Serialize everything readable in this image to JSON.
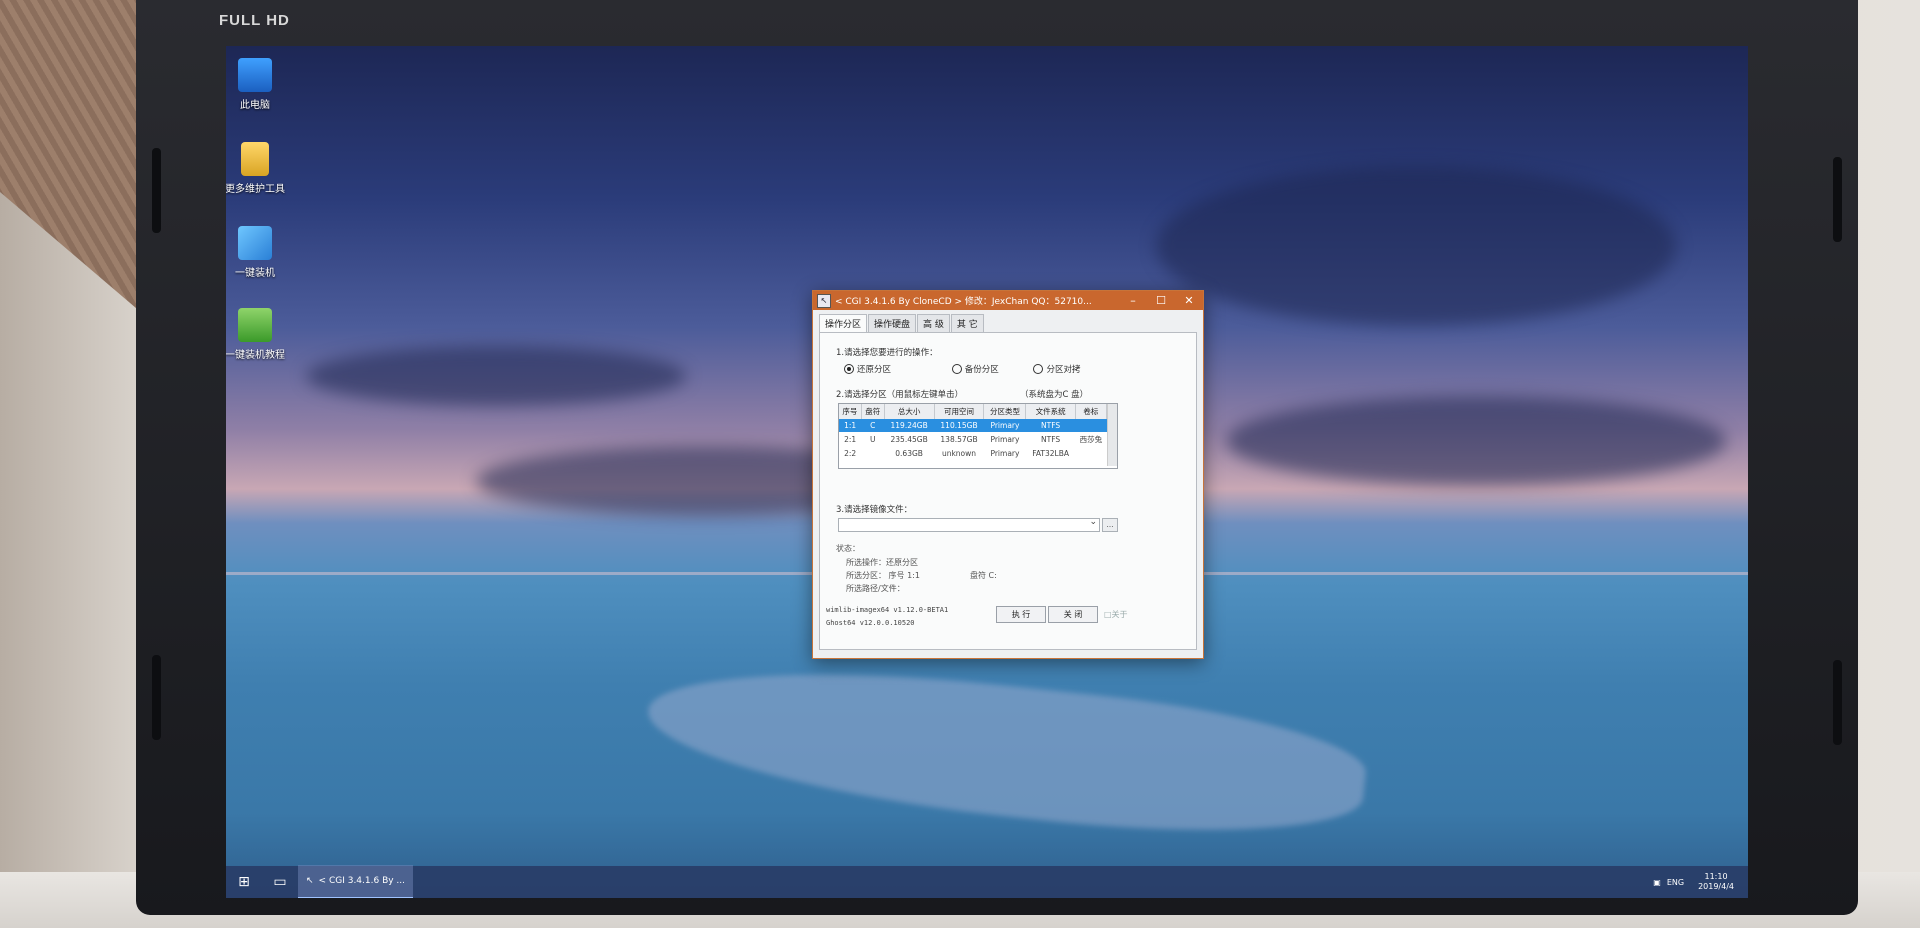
{
  "bezel": {
    "label": "FULL HD"
  },
  "desktop": {
    "icons": [
      {
        "label": "此电脑",
        "icon": "computer-icon"
      },
      {
        "label": "更多维护工具",
        "icon": "folder-icon"
      },
      {
        "label": "一键装机",
        "icon": "install-icon"
      },
      {
        "label": "一键装机教程",
        "icon": "pdf-icon"
      }
    ]
  },
  "window": {
    "title": "< CGI 3.4.1.6 By CloneCD > 修改：JexChan  QQ：52710...",
    "tabs": [
      "操作分区",
      "操作硬盘",
      "高 级",
      "其 它"
    ],
    "step1": {
      "label": "1.请选择您要进行的操作：",
      "options": [
        "还原分区",
        "备份分区",
        "分区对拷"
      ],
      "selected": "还原分区"
    },
    "step2": {
      "label": "2.请选择分区（用鼠标左键单击）",
      "hint": "（系统盘为C 盘）",
      "columns": [
        "序号",
        "盘符",
        "总大小",
        "可用空间",
        "分区类型",
        "文件系统",
        "卷标"
      ],
      "rows": [
        [
          "1:1",
          "C",
          "119.24GB",
          "110.15GB",
          "Primary",
          "NTFS",
          ""
        ],
        [
          "2:1",
          "U",
          "235.45GB",
          "138.57GB",
          "Primary",
          "NTFS",
          "西莎兔"
        ],
        [
          "2:2",
          "",
          "0.63GB",
          "unknown",
          "Primary",
          "FAT32LBA",
          ""
        ]
      ]
    },
    "step3": {
      "label": "3.请选择镜像文件：",
      "value": ""
    },
    "status": {
      "heading": "状态：",
      "op": "所选操作：还原分区",
      "part": "所选分区：  序号 1:1",
      "drive": "盘符 C:",
      "path": "所选路径/文件："
    },
    "versions": [
      "wimlib-imagex64 v1.12.0-BETA1",
      "Ghost64 v12.0.0.10520"
    ],
    "buttons": {
      "run": "执 行",
      "close": "关 闭",
      "after": "□关于"
    }
  },
  "taskbar": {
    "task_label": "< CGI 3.4.1.6 By ...",
    "lang": "ENG",
    "time": "11:10",
    "date": "2019/4/4"
  },
  "colors": {
    "titlebar": "#c9672e",
    "selection": "#2a8fe0",
    "taskbar": "#283a64"
  }
}
